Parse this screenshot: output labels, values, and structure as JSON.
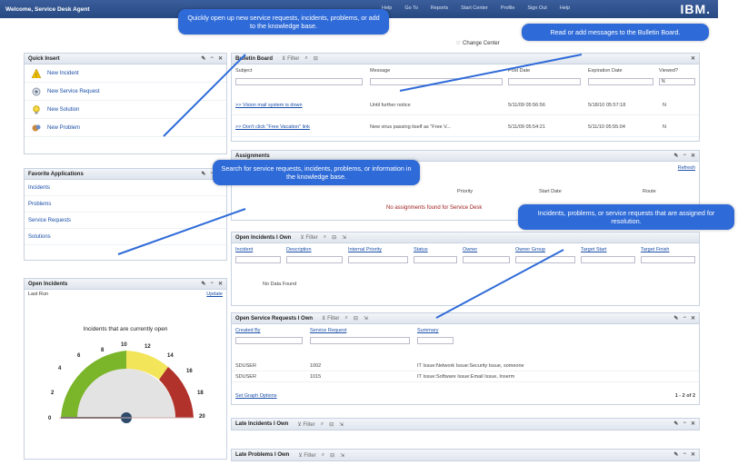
{
  "header": {
    "welcome": "Welcome, Service Desk Agent",
    "links": [
      "Help",
      "Go To",
      "Reports",
      "Start Center",
      "Profile",
      "Sign Out",
      "Help"
    ],
    "brand": "IBM.",
    "change_center": "Change Center"
  },
  "quick_insert": {
    "title": "Quick Insert",
    "items": [
      {
        "label": "New Incident",
        "icon": "warning-icon"
      },
      {
        "label": "New Service Request",
        "icon": "service-request-icon"
      },
      {
        "label": "New Solution",
        "icon": "lightbulb-icon"
      },
      {
        "label": "New Problem",
        "icon": "problem-icon"
      }
    ]
  },
  "favorites": {
    "title": "Favorite Applications",
    "items": [
      "Incidents",
      "Problems",
      "Service Requests",
      "Solutions"
    ]
  },
  "open_incidents": {
    "title": "Open Incidents",
    "last_run": "Last Run",
    "update": "Update",
    "gauge_title": "Incidents that are currently open",
    "labels": [
      "0",
      "2",
      "4",
      "6",
      "8",
      "10",
      "12",
      "14",
      "16",
      "18",
      "20"
    ],
    "value_fraction": 0.0
  },
  "bulletin": {
    "title": "Bulletin Board",
    "filter": "Filter",
    "columns": [
      "Subject",
      "Message",
      "Post Date",
      "Expiration Date",
      "Viewed?"
    ],
    "viewed_filter": "N",
    "rows": [
      {
        "subject": ">> Vision mail system is down",
        "message": "Until further notice",
        "post": "5/11/09 05:56:56",
        "exp": "5/18/10 05:57:18",
        "viewed": "N"
      },
      {
        "subject": ">> Don't click \"Free Vacation\" link",
        "message": "New virus passing itself as \"Free V...",
        "post": "5/11/09 05:54:21",
        "exp": "5/11/10 05:55:04",
        "viewed": "N"
      }
    ]
  },
  "assignments": {
    "title": "Assignments",
    "refresh": "Refresh",
    "columns": [
      "Priority",
      "Start Date",
      "Route"
    ],
    "empty": "No assignments found for Service Desk"
  },
  "incidents_own": {
    "title": "Open Incidents I Own",
    "filter": "Filter",
    "columns": [
      "Incident",
      "Description",
      "Internal Priority",
      "Status",
      "Owner",
      "Owner Group",
      "Target Start",
      "Target Finish"
    ],
    "empty": "No Data Found"
  },
  "sr_own": {
    "title": "Open Service Requests I Own",
    "filter": "Filter",
    "columns": [
      "Created By",
      "Service Request",
      "Summary"
    ],
    "rows": [
      {
        "by": "SDUSER",
        "sr": "1002",
        "summary": "IT Issue:Network Issue:Security Issue, someone"
      },
      {
        "by": "SDUSER",
        "sr": "1015",
        "summary": "IT Issue:Software Issue:Email Issue, Inserm"
      }
    ],
    "graph_options": "Set Graph Options",
    "count": "1 - 2 of 2"
  },
  "late_incidents": {
    "title": "Late Incidents I Own",
    "filter": "Filter"
  },
  "late_problems": {
    "title": "Late Problems I Own",
    "filter": "Filter"
  },
  "callouts": {
    "c1": "Quickly open up new service requests, incidents, problems, or add to the knowledge base.",
    "c2": "Read or add messages to the Bulletin Board.",
    "c3": "Search for service requests, incidents, problems, or information in the knowledge base.",
    "c4": "Incidents, problems, or service requests that are assigned for resolution."
  },
  "colors": {
    "callout": "#2f6bd8",
    "header": "#284a82",
    "link": "#1a4ea8"
  }
}
